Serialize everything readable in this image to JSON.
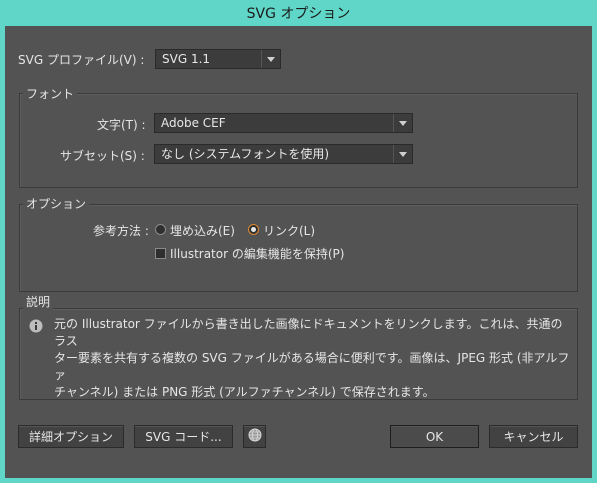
{
  "title": "SVG オプション",
  "profile": {
    "label": "SVG プロファイル(V) :",
    "value": "SVG 1.1"
  },
  "font_group": {
    "title": "フォント",
    "char_label": "文字(T) :",
    "char_value": "Adobe CEF",
    "subset_label": "サブセット(S) :",
    "subset_value": "なし (システムフォントを使用)"
  },
  "options_group": {
    "title": "オプション",
    "ref_label": "参考方法 :",
    "radio_embed": "埋め込み(E)",
    "radio_link": "リンク(L)",
    "selected": "link",
    "checkbox_label": "Illustrator の編集機能を保持(P)",
    "checkbox_checked": false
  },
  "description": {
    "title": "説明",
    "lines": [
      "元の Illustrator ファイルから書き出した画像にドキュメントをリンクします。これは、共通のラス",
      "ター要素を共有する複数の SVG ファイルがある場合に便利です。画像は、JPEG 形式 (非アルファ",
      "チャンネル) または PNG 形式 (アルファチャンネル) で保存されます。"
    ]
  },
  "buttons": {
    "advanced": "詳細オプション",
    "svg_code": "SVG コード...",
    "ok": "OK",
    "cancel": "キャンセル"
  },
  "icons": {
    "info": "info-icon",
    "browser": "globe-icon"
  }
}
